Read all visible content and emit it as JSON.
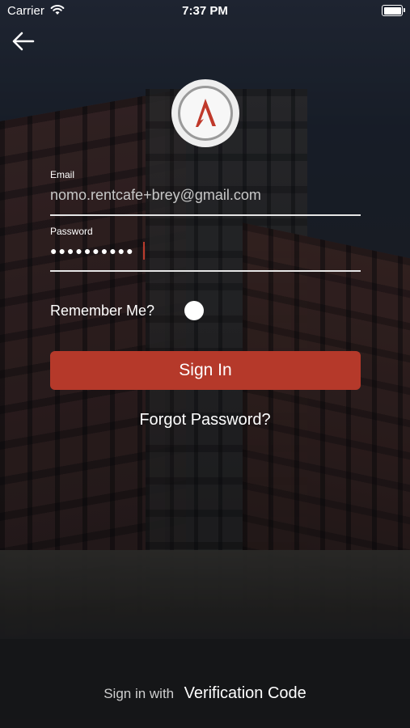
{
  "status_bar": {
    "carrier": "Carrier",
    "time": "7:37 PM"
  },
  "login": {
    "email_label": "Email",
    "email_value": "nomo.rentcafe+brey@gmail.com",
    "password_label": "Password",
    "password_masked": "●●●●●●●●●●",
    "remember_label": "Remember Me?",
    "remember_on": false,
    "sign_in_label": "Sign In",
    "forgot_label": "Forgot Password?"
  },
  "footer": {
    "prefix": "Sign in with",
    "link": "Verification Code"
  },
  "colors": {
    "accent": "#b5392a",
    "logo_red": "#c0392b"
  }
}
